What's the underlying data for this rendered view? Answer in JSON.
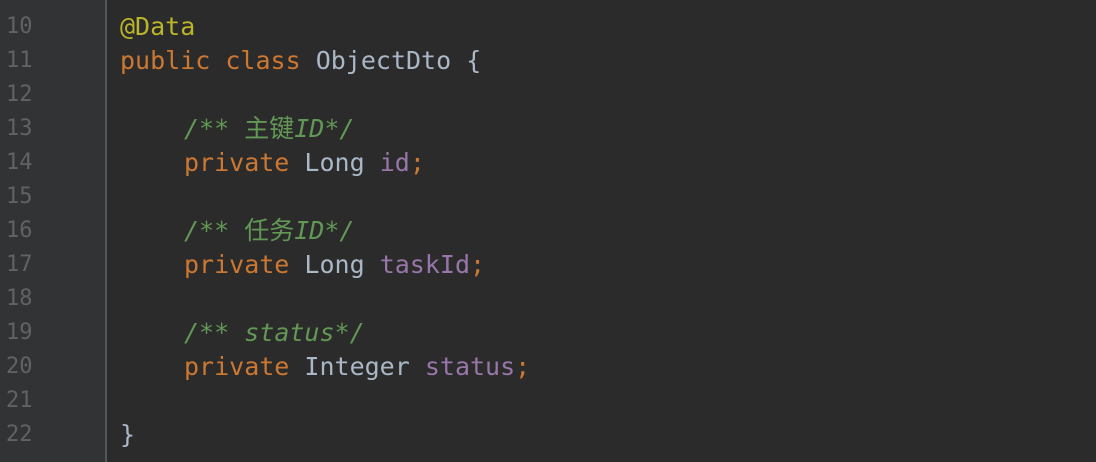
{
  "gutter": {
    "line_numbers": [
      "10",
      "11",
      "12",
      "13",
      "14",
      "15",
      "16",
      "17",
      "18",
      "19",
      "20",
      "21",
      "22"
    ]
  },
  "code": {
    "annotation": "@Data",
    "class_decl": {
      "public_kw": "public",
      "class_kw": "class",
      "name": "ObjectDto",
      "open_brace": "{"
    },
    "fields": [
      {
        "comment_open": "/**",
        "comment_text_cjk": "主键",
        "comment_text": "ID",
        "comment_close": "*/",
        "modifier": "private",
        "type": "Long",
        "name": "id",
        "semicolon": ";"
      },
      {
        "comment_open": "/**",
        "comment_text_cjk": "任务",
        "comment_text": "ID",
        "comment_close": "*/",
        "modifier": "private",
        "type": "Long",
        "name": "taskId",
        "semicolon": ";"
      },
      {
        "comment_open": "/**",
        "comment_text_cjk": "",
        "comment_text": "status",
        "comment_close": "*/",
        "modifier": "private",
        "type": "Integer",
        "name": "status",
        "semicolon": ";"
      }
    ],
    "close_brace": "}"
  },
  "colors": {
    "background": "#2b2b2b",
    "gutter": "#313335",
    "line_number": "#606366",
    "keyword": "#cc7832",
    "annotation": "#bbb529",
    "comment": "#629755",
    "field": "#9876aa",
    "text": "#a9b7c6"
  }
}
